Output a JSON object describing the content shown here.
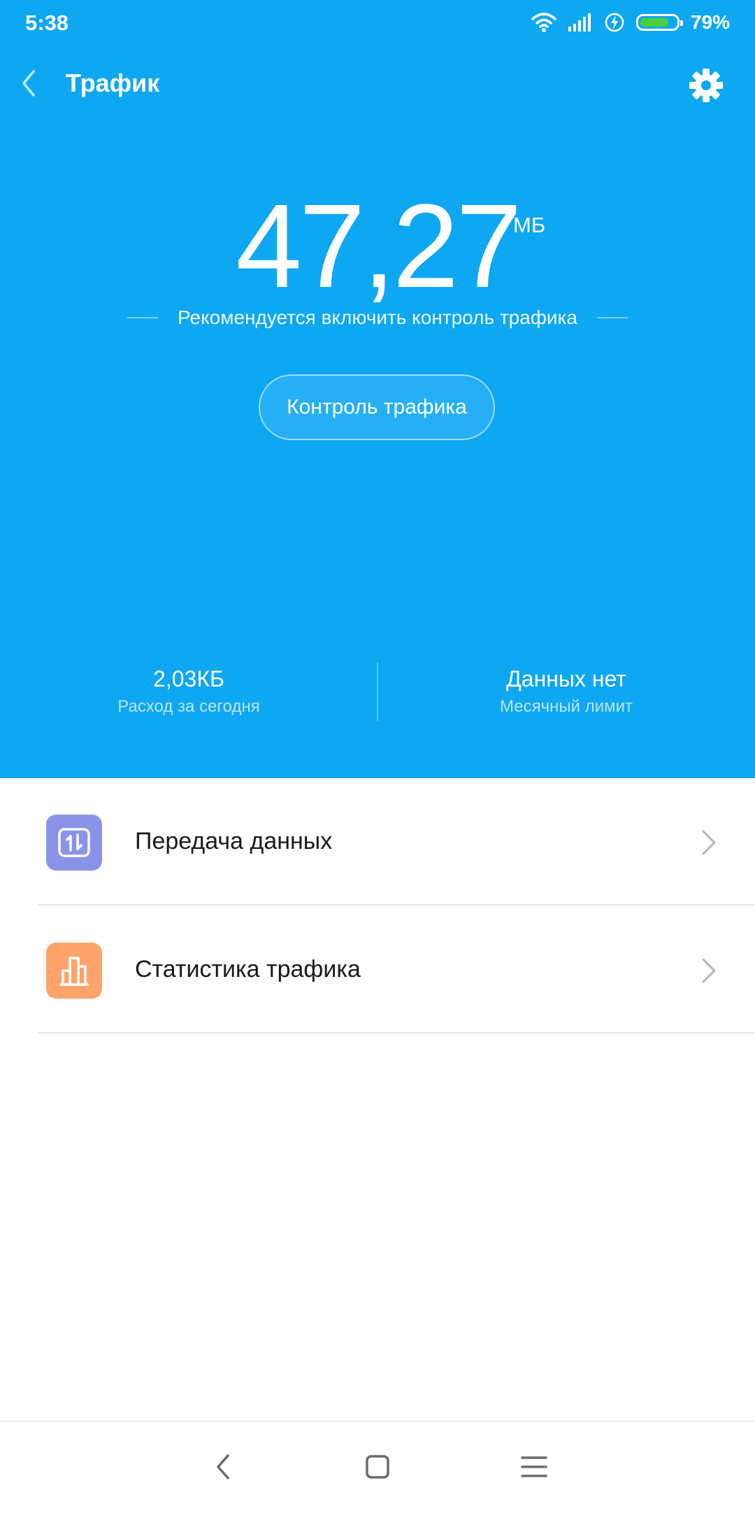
{
  "colors": {
    "primary": "#0ea7f2",
    "battery_fill": "#4cd137",
    "data_transfer_icon_bg": "#8b93e8",
    "traffic_stats_icon_bg": "#ffa46a"
  },
  "status_bar": {
    "time": "5:38",
    "battery_percent": "79%",
    "battery_level": 0.79,
    "icons": [
      "wifi-icon",
      "signal-icon",
      "charging-icon",
      "battery-icon"
    ]
  },
  "header": {
    "title": "Трафик",
    "back_icon": "chevron-left-icon",
    "settings_icon": "gear-icon"
  },
  "usage": {
    "value": "47,27",
    "unit": "МБ",
    "hint": "Рекомендуется включить контроль трафика",
    "control_button": "Контроль трафика"
  },
  "stats": {
    "today": {
      "value": "2,03КБ",
      "label": "Расход за сегодня"
    },
    "monthly": {
      "value": "Данных нет",
      "label": "Месячный лимит"
    }
  },
  "menu": {
    "data_transfer": {
      "label": "Передача данных",
      "icon": "data-transfer-icon"
    },
    "traffic_stats": {
      "label": "Статистика трафика",
      "icon": "bar-chart-icon"
    }
  },
  "nav": {
    "back_icon": "back-icon",
    "home_icon": "home-icon",
    "menu_icon": "menu-icon"
  }
}
